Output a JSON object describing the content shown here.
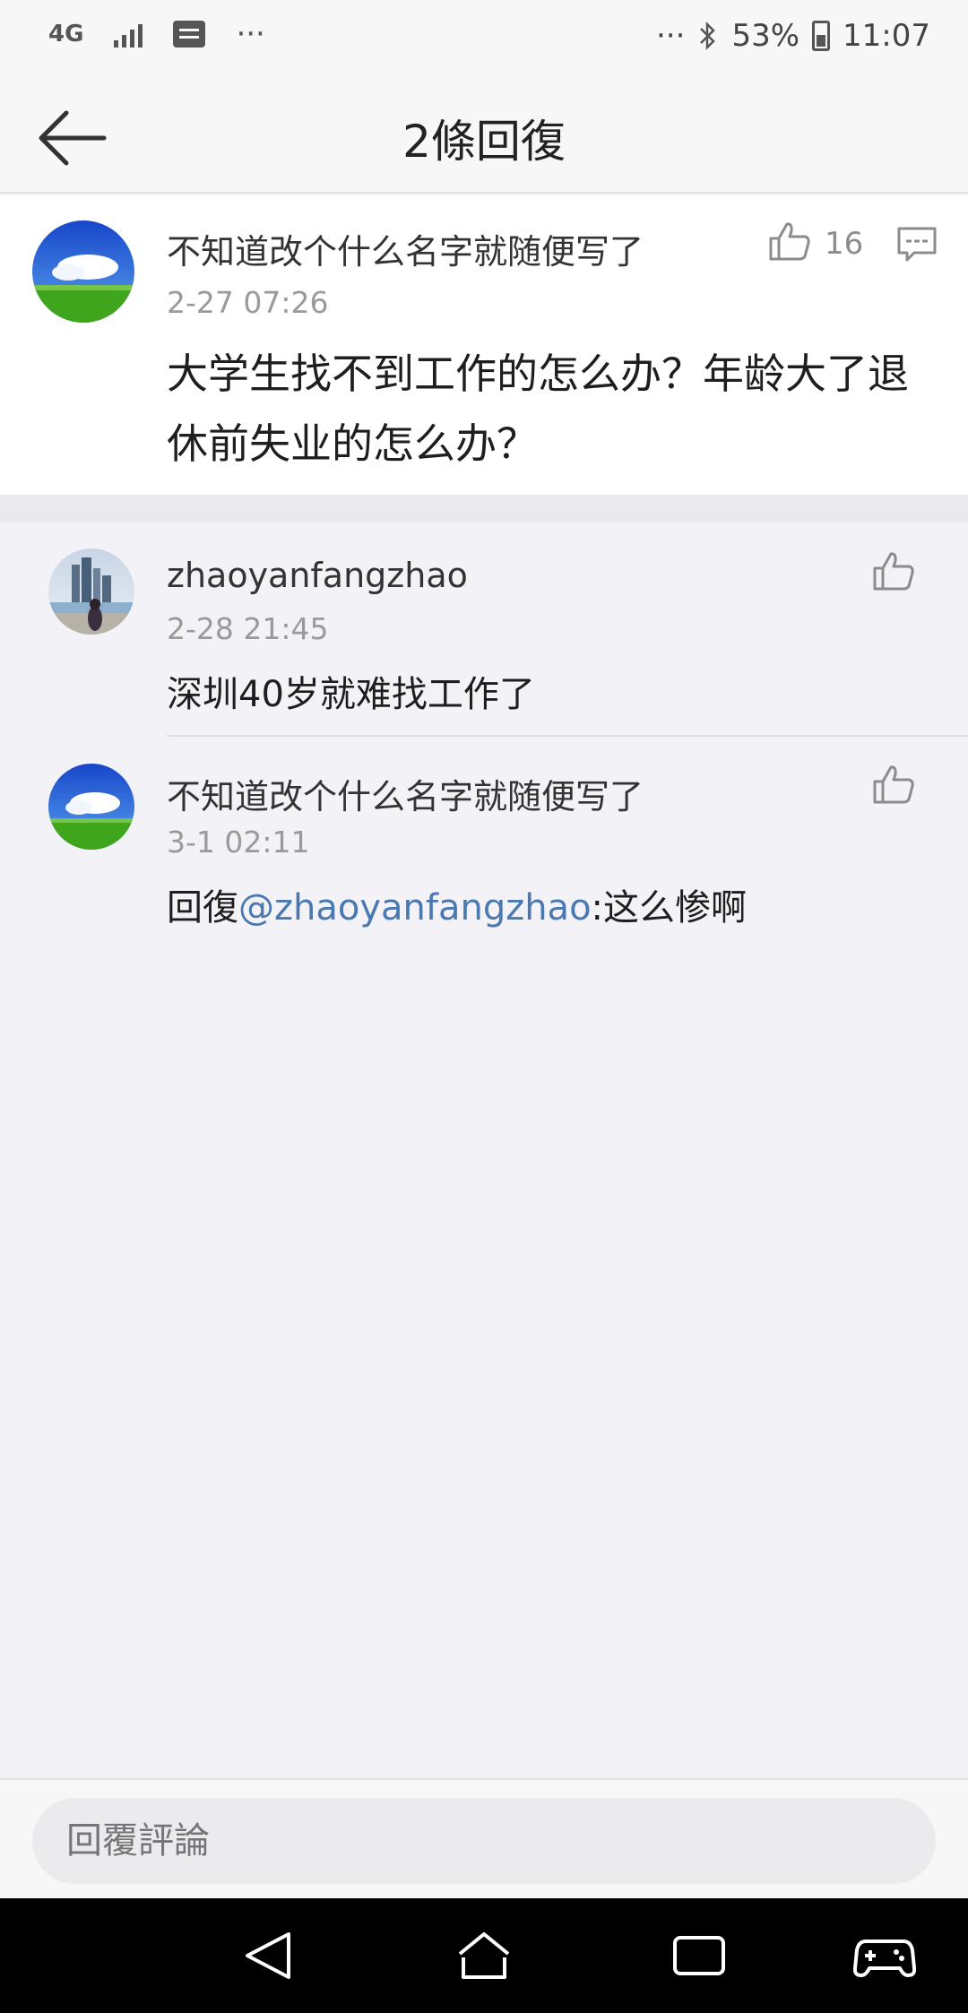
{
  "status_bar": {
    "network": "4G",
    "more_left": "···",
    "more_right": "···",
    "battery": "53%",
    "time": "11:07"
  },
  "header": {
    "title": "2條回復"
  },
  "main_comment": {
    "user_name": "不知道改个什么名字就随便写了",
    "time": "2-27 07:26",
    "text": "大学生找不到工作的怎么办？年龄大了退休前失业的怎么办？",
    "like_count": "16"
  },
  "replies": [
    {
      "user_name": "zhaoyanfangzhao",
      "time": "2-28 21:45",
      "text": "深圳40岁就难找工作了"
    },
    {
      "user_name": "不知道改个什么名字就随便写了",
      "time": "3-1 02:11",
      "reply_prefix": "回復",
      "mention": "@zhaoyanfangzhao",
      "reply_suffix": ":这么惨啊"
    }
  ],
  "bottom_bar": {
    "reply_placeholder": "回覆評論"
  },
  "icons": {
    "back": "arrow-left-icon",
    "like": "thumbs-up-icon",
    "comment": "comment-bubble-icon",
    "nav_back": "triangle-back-icon",
    "nav_home": "home-icon",
    "nav_recent": "recent-apps-icon",
    "nav_game": "gamepad-icon"
  },
  "colors": {
    "mention": "#4a78b0",
    "background": "#f3f3f7"
  }
}
